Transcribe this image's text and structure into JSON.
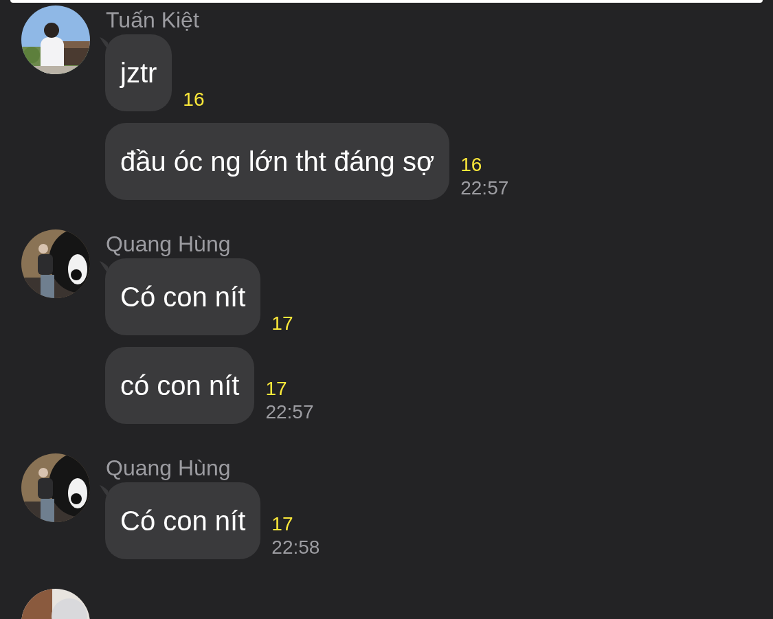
{
  "groups": [
    {
      "sender": "Tuấn Kiệt",
      "avatar": {
        "kind": "picture"
      },
      "messages": [
        {
          "text": "jztr",
          "count": "16"
        },
        {
          "text": "đầu óc ng lớn tht đáng sợ",
          "count": "16",
          "time": "22:57"
        }
      ]
    },
    {
      "sender": "Quang Hùng",
      "avatar": {
        "kind": "picture"
      },
      "messages": [
        {
          "text": "Có con nít",
          "count": "17"
        },
        {
          "text": "có con nít",
          "count": "17",
          "time": "22:57"
        }
      ]
    },
    {
      "sender": "Quang Hùng",
      "avatar": {
        "kind": "picture"
      },
      "messages": [
        {
          "text": "Có con nít",
          "count": "17",
          "time": "22:58"
        }
      ]
    },
    {
      "avatar": {
        "kind": "picture"
      }
    }
  ]
}
